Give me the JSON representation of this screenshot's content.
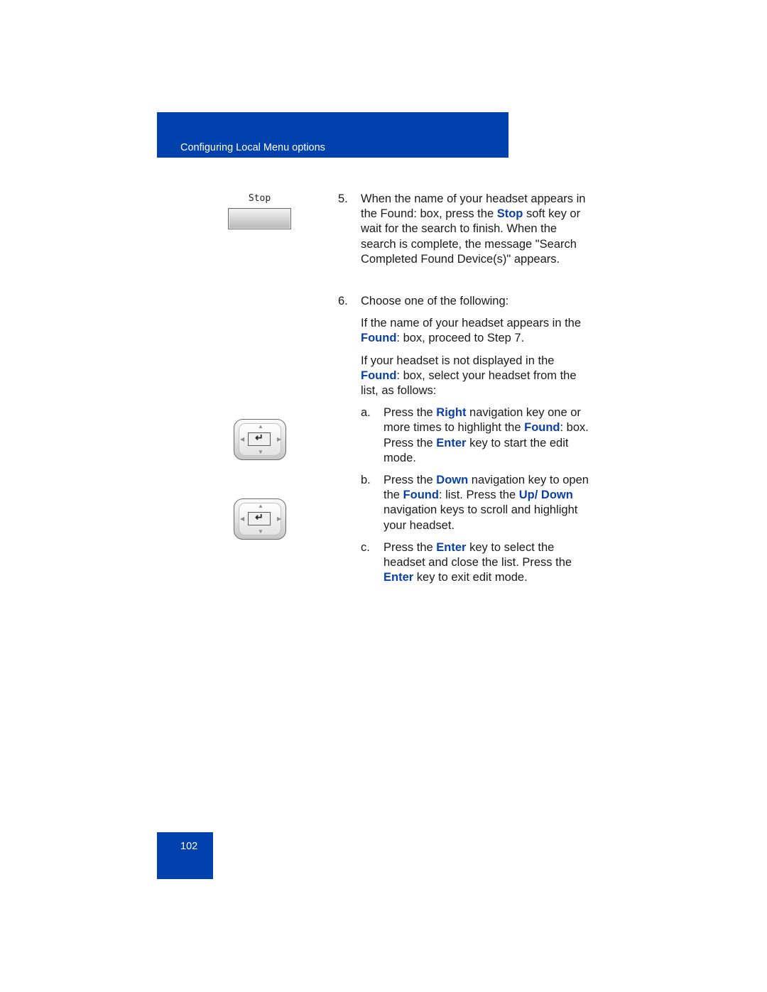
{
  "header": {
    "title": "Configuring Local Menu options"
  },
  "page_number": "102",
  "softkey": {
    "label": "Stop",
    "icon": "softkey-button"
  },
  "nav_icons": [
    "navigation-cluster-icon",
    "navigation-cluster-icon"
  ],
  "step5": {
    "num": "5.",
    "t1": "When the name of your headset appears in the Found: box, press the ",
    "k1": "Stop",
    "t2": " soft key or wait for the search to finish. When the search is complete, the message \"Search Completed Found Device(s)\" appears."
  },
  "step6": {
    "num": "6.",
    "text": "Choose one of the following:",
    "p1": {
      "t1": "If the name of your headset appears in the ",
      "k1": "Found",
      "t2": ": box, proceed to Step 7."
    },
    "p2": {
      "t1": "If your headset is not displayed in the ",
      "k1": "Found",
      "t2": ": box, select your headset from the list, as follows:"
    },
    "a": {
      "num": "a.",
      "t1": "Press the ",
      "k1": "Right",
      "t2": " navigation key one or more times to highlight the ",
      "k2": "Found",
      "t3": ": box. Press the ",
      "k3": "Enter",
      "t4": " key to start the edit mode."
    },
    "b": {
      "num": "b.",
      "t1": "Press the ",
      "k1": "Down",
      "t2": " navigation key to open the ",
      "k2": "Found",
      "t3": ": list. Press the ",
      "k3": "Up/ Down",
      "t4": " navigation keys to scroll and highlight your headset."
    },
    "c": {
      "num": "c.",
      "t1": "Press the ",
      "k1": "Enter",
      "t2": " key to select the headset and close the list. Press the ",
      "k2": "Enter",
      "t3": " key to exit edit mode."
    }
  }
}
